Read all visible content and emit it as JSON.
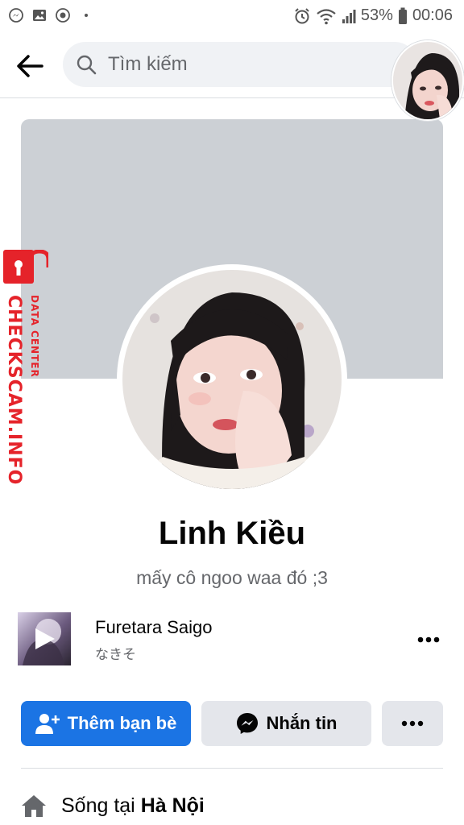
{
  "status_bar": {
    "battery": "53%",
    "time": "00:06"
  },
  "header": {
    "search_placeholder": "Tìm kiếm"
  },
  "watermark": {
    "main": "CHECKSCAM.INFO",
    "sub": "DATA CENTER"
  },
  "profile": {
    "name": "Linh Kiều",
    "bio": "mấy cô ngoo waa đó ;3"
  },
  "music": {
    "title": "Furetara Saigo",
    "artist": "なきそ"
  },
  "actions": {
    "add_friend": "Thêm bạn bè",
    "message": "Nhắn tin"
  },
  "info": {
    "lives_in_prefix": "Sống tại",
    "lives_in_city": "Hà Nội"
  },
  "colors": {
    "primary": "#1b74e4",
    "secondary_button": "#e4e6eb",
    "cover": "#ccd0d5",
    "watermark": "#e5232a"
  }
}
